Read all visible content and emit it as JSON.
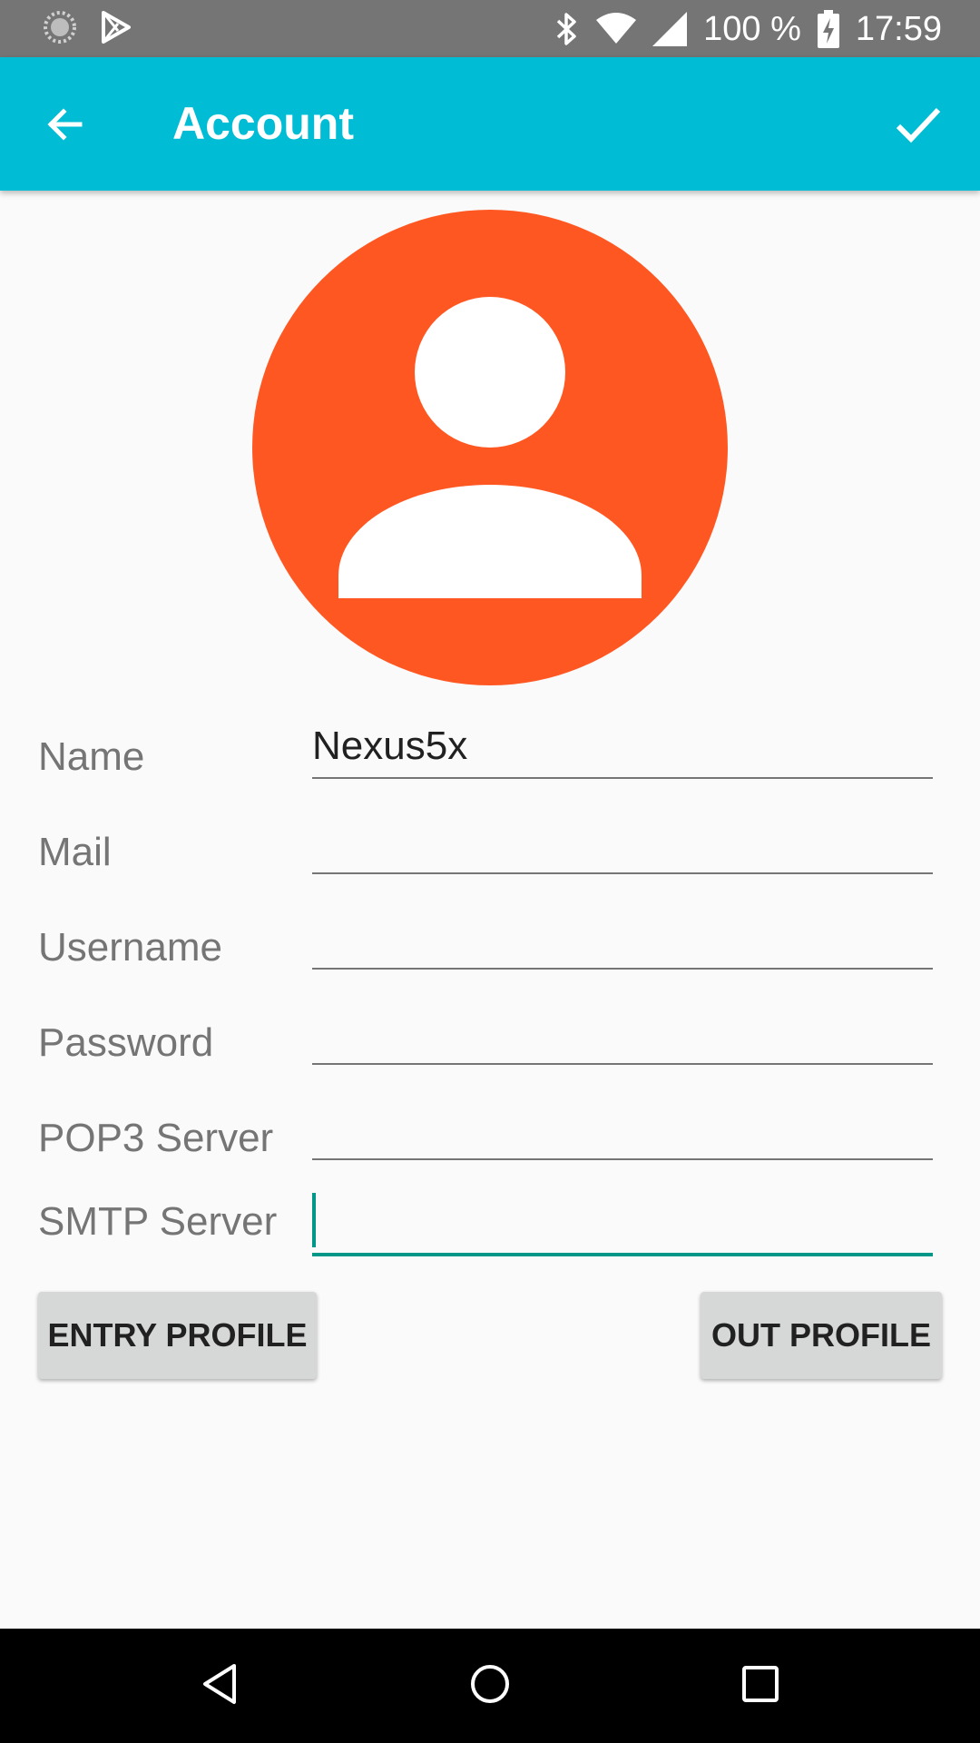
{
  "status_bar": {
    "battery": "100 %",
    "time": "17:59"
  },
  "app_bar": {
    "title": "Account",
    "back_icon": "arrow-back-icon",
    "confirm_icon": "check-icon"
  },
  "avatar": {
    "icon": "person-icon",
    "color": "#ff5722"
  },
  "form": {
    "fields": [
      {
        "label": "Name",
        "value": "Nexus5x"
      },
      {
        "label": "Mail",
        "value": ""
      },
      {
        "label": "Username",
        "value": ""
      },
      {
        "label": "Password",
        "value": ""
      },
      {
        "label": "POP3 Server",
        "value": ""
      },
      {
        "label": "SMTP Server",
        "value": ""
      }
    ]
  },
  "buttons": {
    "entry_profile": "ENTRY PROFILE",
    "out_profile": "OUT PROFILE"
  },
  "colors": {
    "status_bar": "#757575",
    "app_bar": "#00bcd4",
    "focus_accent": "#009688",
    "button_bg": "#d6d7d7"
  }
}
